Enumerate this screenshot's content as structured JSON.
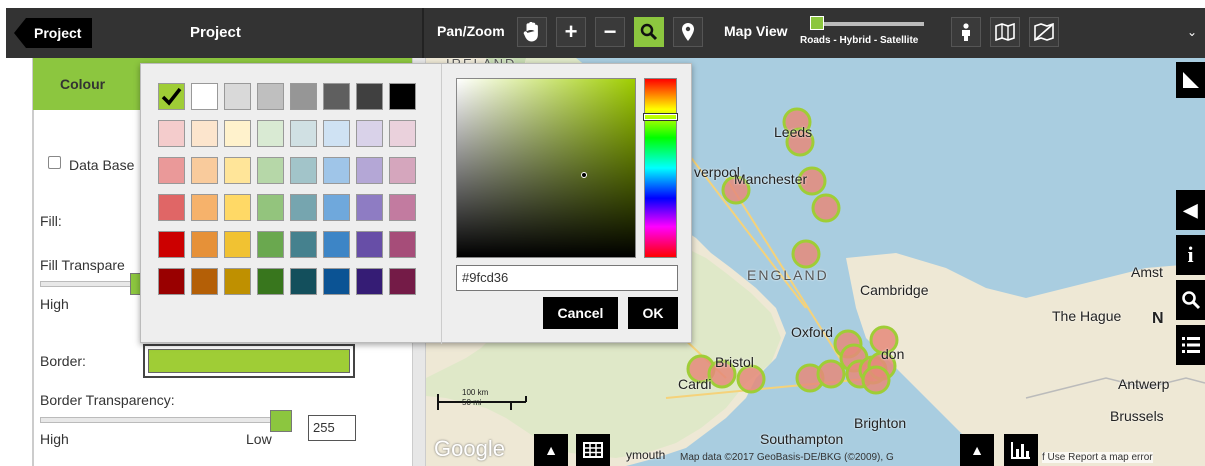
{
  "toolbar": {
    "back_label": "Project",
    "title": "Project",
    "panzoom_label": "Pan/Zoom",
    "mapview_label": "Map View",
    "mapview_slider_caption": "Roads - Hybrid - Satellite",
    "accent": "#8cc63f"
  },
  "panel": {
    "tab_label": "Colour",
    "data_based_label": "Data Base",
    "fill_label": "Fill:",
    "fill_transparency_label": "Fill Transpare",
    "fill_transparency_low_label": "High",
    "border_label": "Border:",
    "border_color": "#9fcd36",
    "border_transparency_label": "Border Transparency:",
    "border_transparency_high": "High",
    "border_transparency_low": "Low",
    "border_transparency_value": "255",
    "border_transparency_level": 1.0
  },
  "picker": {
    "hex_value": "#9fcd36",
    "cancel_label": "Cancel",
    "ok_label": "OK",
    "selected_swatch": "#9fcd36",
    "swatches": [
      [
        "#9fcd36",
        "#ffffff",
        "#d9d9d9",
        "#bfbfbf",
        "#969696",
        "#5f5f5f",
        "#404040",
        "#000000"
      ],
      [
        "#f4cccc",
        "#fce5cd",
        "#fff2cc",
        "#d9ead3",
        "#d0e0e3",
        "#cfe2f3",
        "#d9d2e9",
        "#ead1dc"
      ],
      [
        "#ea9999",
        "#f9cb9c",
        "#ffe599",
        "#b6d7a8",
        "#a2c4c9",
        "#9fc5e8",
        "#b4a7d6",
        "#d5a6bd"
      ],
      [
        "#e06666",
        "#f6b26b",
        "#ffd966",
        "#93c47d",
        "#76a5af",
        "#6fa8dc",
        "#8e7cc3",
        "#c27ba0"
      ],
      [
        "#cc0000",
        "#e69138",
        "#f1c232",
        "#6aa84f",
        "#45818e",
        "#3d85c6",
        "#674ea7",
        "#a64d79"
      ],
      [
        "#990000",
        "#b45f06",
        "#bf9000",
        "#38761d",
        "#134f5c",
        "#0b5394",
        "#351c75",
        "#741b47"
      ]
    ]
  },
  "map": {
    "labels": {
      "ireland": "IRELAND",
      "england": "ENGLAND",
      "leeds": "Leeds",
      "liverpool": "verpool",
      "manchester": "Manchester",
      "cambridge": "Cambridge",
      "oxford": "Oxford",
      "london": "don",
      "bristol": "Bristol",
      "cardiff": "Cardi",
      "brighton": "Brighton",
      "southampton": "Southampton",
      "amsterdam": "Amst",
      "the_hague": "The Hague",
      "antwerp": "Antwerp",
      "brussels": "Brussels",
      "yarmouth": "ymouth",
      "n_label": "N"
    },
    "scale_km": "100 km",
    "scale_mi": "50 mi",
    "google": "Google",
    "attribution": "Map data ©2017 GeoBasis-DE/BKG (©2009), G",
    "attribution_tail": "f Use   Report a map error"
  }
}
